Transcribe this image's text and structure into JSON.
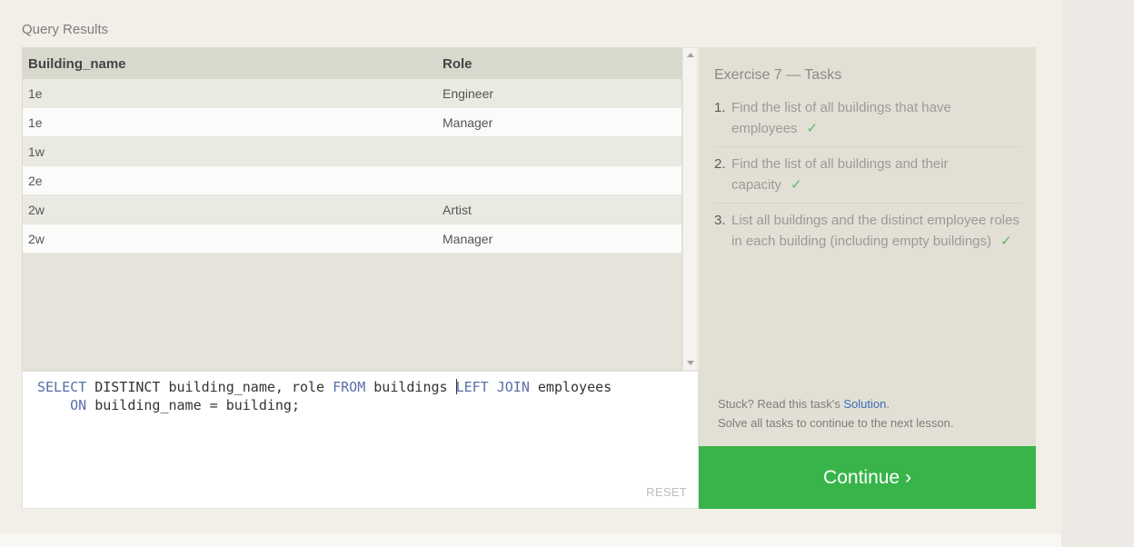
{
  "results": {
    "title": "Query Results",
    "columns": [
      "Building_name",
      "Role"
    ],
    "rows": [
      [
        "1e",
        "Engineer"
      ],
      [
        "1e",
        "Manager"
      ],
      [
        "1w",
        ""
      ],
      [
        "2e",
        ""
      ],
      [
        "2w",
        "Artist"
      ],
      [
        "2w",
        "Manager"
      ]
    ]
  },
  "editor": {
    "line1": {
      "kw1": "SELECT",
      "text1": " DISTINCT building_name, role ",
      "kw2": "FROM",
      "text2": " buildings ",
      "kw3": "LEFT JOIN",
      "text3": " employees"
    },
    "line2": {
      "indent": "    ",
      "kw1": "ON",
      "text1": " building_name = building;"
    },
    "reset_label": "RESET"
  },
  "tasks": {
    "title": "Exercise 7 — Tasks",
    "items": [
      {
        "num": "1.",
        "text": "Find the list of all buildings that have employees",
        "check": "✓"
      },
      {
        "num": "2.",
        "text": "Find the list of all buildings and their capacity",
        "check": "✓"
      },
      {
        "num": "3.",
        "text": "List all buildings and the distinct employee roles in each building (including empty buildings)",
        "check": "✓"
      }
    ],
    "stuck_prefix": "Stuck? Read this task's ",
    "solution_label": "Solution",
    "stuck_suffix": ".",
    "solve_all": "Solve all tasks to continue to the next lesson."
  },
  "continue_label": "Continue ›",
  "colors": {
    "accent_green": "#38b44a",
    "keyword_blue": "#5a6ea8",
    "link_blue": "#3a6bbf"
  }
}
